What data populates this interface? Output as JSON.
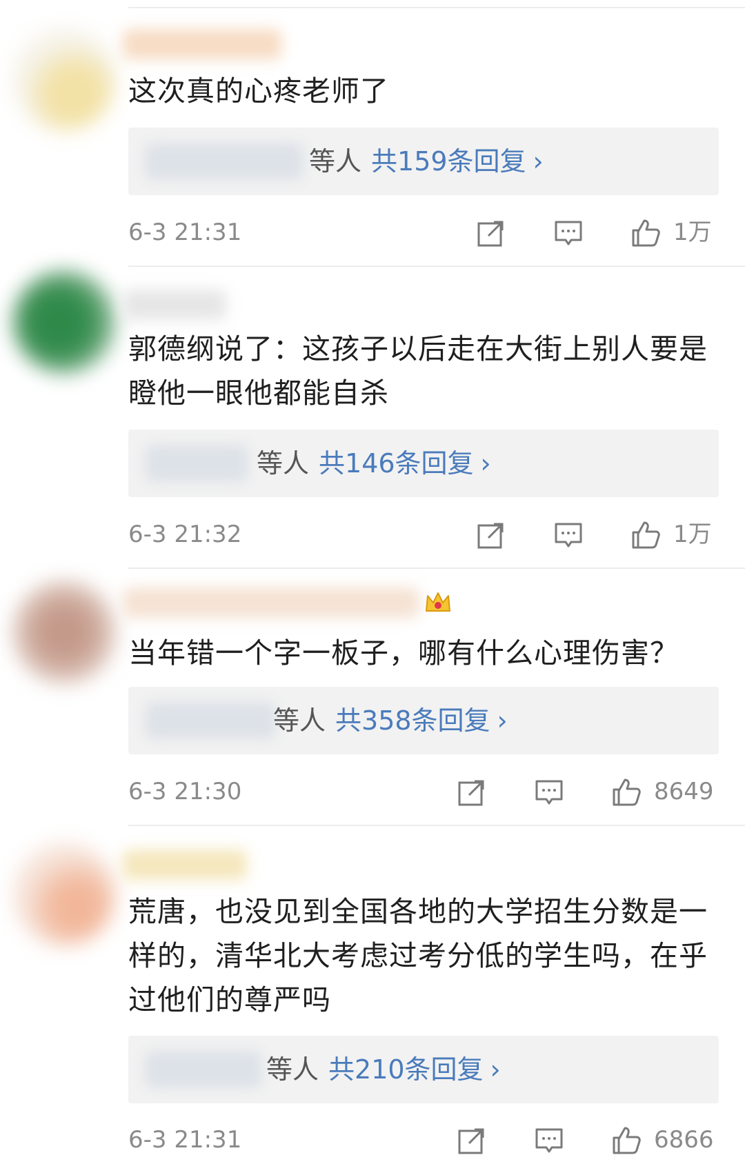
{
  "comments": [
    {
      "text": "这次真的心疼老师了",
      "reply_who": "等人",
      "reply_count": "共159条回复",
      "time": "6-3 21:31",
      "likes": "1万"
    },
    {
      "text": "郭德纲说了：这孩子以后走在大街上别人要是瞪他一眼他都能自杀",
      "reply_who": "等人",
      "reply_count": "共146条回复",
      "time": "6-3 21:32",
      "likes": "1万"
    },
    {
      "text": "当年错一个字一板子，哪有什么心理伤害？",
      "reply_who": "等人",
      "reply_count": "共358条回复",
      "time": "6-3 21:30",
      "likes": "8649"
    },
    {
      "text": "荒唐，也没见到全国各地的大学招生分数是一样的，清华北大考虑过考分低的学生吗，在乎过他们的尊严吗",
      "reply_who": "等人",
      "reply_count": "共210条回复",
      "time": "6-3 21:31",
      "likes": "6866"
    }
  ],
  "icons": {
    "share": "share-icon",
    "comment": "comment-icon",
    "like": "thumbs-up-icon",
    "reply_more": "chevron-right-icon",
    "vip": "crown-icon"
  },
  "colors": {
    "link": "#4a7bbb",
    "meta": "#8a8a8a",
    "reply_bg": "#f2f2f2"
  }
}
